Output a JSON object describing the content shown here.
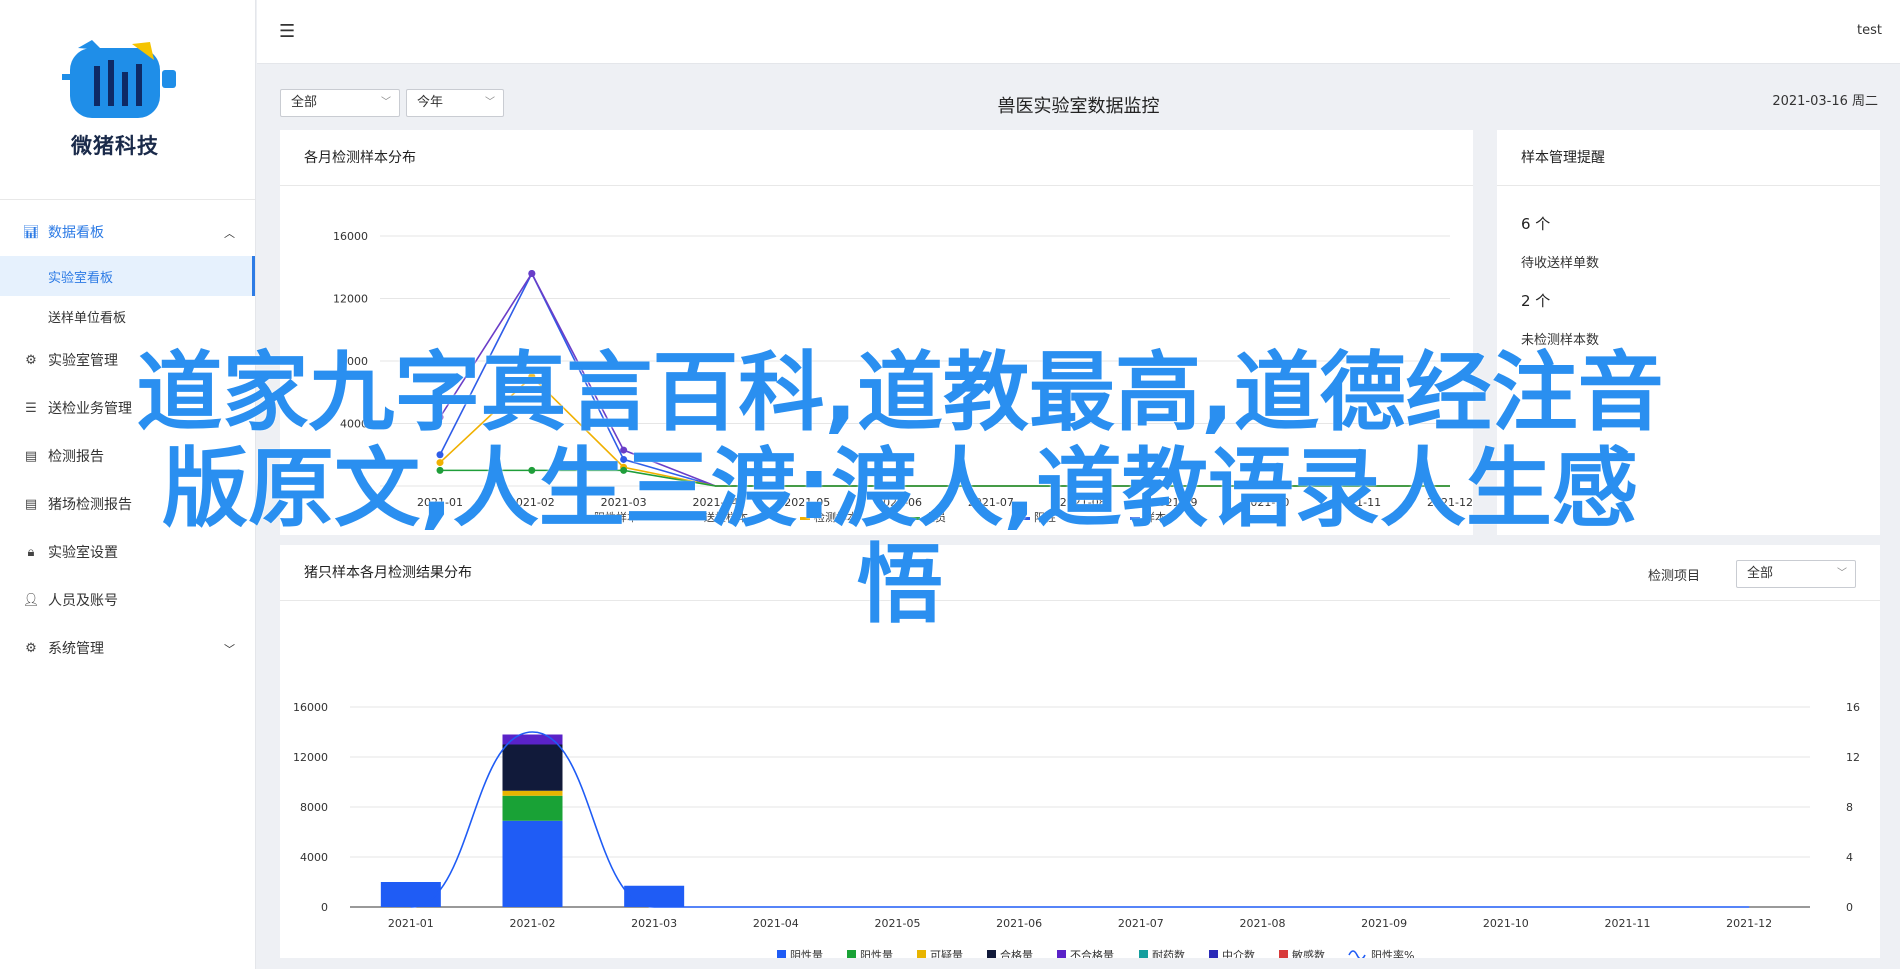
{
  "app": {
    "brand": "微猪科技",
    "user": "test"
  },
  "sidebar": {
    "groups": [
      {
        "label": "数据看板",
        "icon": "chart-icon",
        "children": [
          "实验室看板",
          "送样单位看板"
        ]
      },
      {
        "label": "实验室管理",
        "icon": "gear-icon"
      },
      {
        "label": "送检业务管理",
        "icon": "list-icon"
      },
      {
        "label": "检测报告",
        "icon": "doc-icon"
      },
      {
        "label": "猪场检测报告",
        "icon": "doc-icon"
      },
      {
        "label": "实验室设置",
        "icon": "lock-icon"
      },
      {
        "label": "人员及账号",
        "icon": "user-icon"
      },
      {
        "label": "系统管理",
        "icon": "gear-icon"
      }
    ]
  },
  "filters": {
    "scope": "全部",
    "period": "今年"
  },
  "page": {
    "title": "兽医实验室数据监控",
    "date": "2021-03-16 周二"
  },
  "panel1": {
    "title": "各月检测样本分布",
    "legend": [
      "阳性样本",
      "送检样本",
      "检测样本",
      "人员",
      "阳性",
      "样本"
    ]
  },
  "panel2": {
    "title": "样本管理提醒",
    "items": [
      {
        "value": "6 个",
        "label": "待收送样单数"
      },
      {
        "value": "2 个",
        "label": "未检测样本数"
      }
    ]
  },
  "panel3": {
    "title": "猪只样本各月检测结果分布",
    "filter_label": "检测项目",
    "filter_value": "全部",
    "legend": [
      "阴性量",
      "阳性量",
      "可疑量",
      "合格量",
      "不合格量",
      "耐药数",
      "中介数",
      "敏感数",
      "阳性率%"
    ]
  },
  "overlay": {
    "line1": "道家九字真言百科,道教最高,道德经注音",
    "line2": "版原文,人生三渡:渡人,道教语录人生感",
    "line3": "悟"
  },
  "chart_data": [
    {
      "type": "line",
      "title": "各月检测样本分布",
      "x": [
        "2021-01",
        "2021-02",
        "2021-03",
        "2021-04",
        "2021-05",
        "2021-06",
        "2021-07",
        "2021-08",
        "2021-09",
        "2021-10",
        "2021-11",
        "2021-12"
      ],
      "ylim": [
        0,
        16000
      ],
      "yticks": [
        0,
        4000,
        8000,
        12000,
        16000
      ],
      "series": [
        {
          "name": "阳性样本",
          "color": "#2f5de8",
          "values": [
            2000,
            13600,
            1700,
            0,
            0,
            0,
            0,
            0,
            0,
            0,
            0,
            0
          ]
        },
        {
          "name": "送检样本",
          "color": "#6a3ec8",
          "values": [
            4400,
            13600,
            2300,
            0,
            0,
            0,
            0,
            0,
            0,
            0,
            0,
            0
          ]
        },
        {
          "name": "检测样本",
          "color": "#f0b000",
          "values": [
            1500,
            7000,
            1200,
            0,
            0,
            0,
            0,
            0,
            0,
            0,
            0,
            0
          ]
        },
        {
          "name": "人员",
          "color": "#1f9e3a",
          "values": [
            1000,
            1000,
            1000,
            0,
            0,
            0,
            0,
            0,
            0,
            0,
            0,
            0
          ]
        }
      ]
    },
    {
      "type": "bar",
      "title": "猪只样本各月检测结果分布",
      "categories": [
        "2021-01",
        "2021-02",
        "2021-03",
        "2021-04",
        "2021-05",
        "2021-06",
        "2021-07",
        "2021-08",
        "2021-09",
        "2021-10",
        "2021-11",
        "2021-12"
      ],
      "ylim": [
        0,
        16000
      ],
      "yticks": [
        0,
        4000,
        8000,
        12000,
        16000
      ],
      "y2lim": [
        0,
        16
      ],
      "y2ticks": [
        0,
        4,
        8,
        12,
        16
      ],
      "stacked": true,
      "series": [
        {
          "name": "阴性量",
          "color": "#1f5cf5",
          "values": [
            2000,
            6900,
            1700,
            0,
            0,
            0,
            0,
            0,
            0,
            0,
            0,
            0
          ]
        },
        {
          "name": "阳性量",
          "color": "#19a236",
          "values": [
            0,
            2000,
            0,
            0,
            0,
            0,
            0,
            0,
            0,
            0,
            0,
            0
          ]
        },
        {
          "name": "可疑量",
          "color": "#e8b400",
          "values": [
            0,
            400,
            0,
            0,
            0,
            0,
            0,
            0,
            0,
            0,
            0,
            0
          ]
        },
        {
          "name": "合格量",
          "color": "#111a3a",
          "values": [
            0,
            3700,
            0,
            0,
            0,
            0,
            0,
            0,
            0,
            0,
            0,
            0
          ]
        },
        {
          "name": "不合格量",
          "color": "#5a22c8",
          "values": [
            0,
            800,
            0,
            0,
            0,
            0,
            0,
            0,
            0,
            0,
            0,
            0
          ]
        }
      ],
      "line_series": {
        "name": "阳性率%",
        "color": "#1f5cf5",
        "values": [
          0,
          14,
          0,
          0,
          0,
          0,
          0,
          0,
          0,
          0,
          0,
          0
        ]
      }
    }
  ]
}
